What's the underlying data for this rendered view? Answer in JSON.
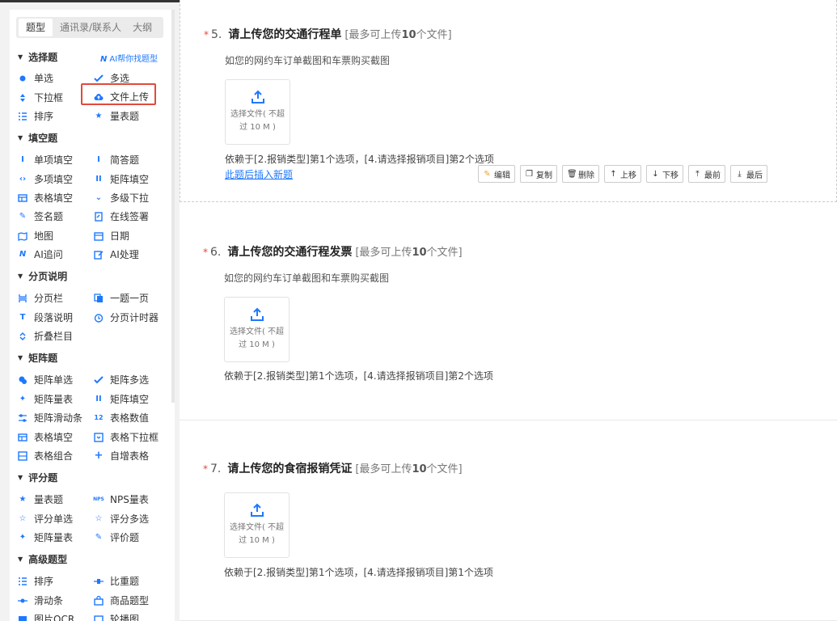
{
  "colors": {
    "accent": "#1e78ff",
    "required": "#e04a3b",
    "highlight": "#e04a3b"
  },
  "sidebar": {
    "tabs": [
      "题型",
      "通讯录/联系人",
      "大纲"
    ],
    "ai_find": "AI帮你找题型",
    "categories": {
      "choice": "选择题",
      "fill": "填空题",
      "paging": "分页说明",
      "matrix": "矩阵题",
      "rating": "评分题",
      "advanced": "高级题型"
    },
    "items": {
      "single": "单选",
      "multi": "多选",
      "dropdown": "下拉框",
      "file_upload": "文件上传",
      "sort": "排序",
      "scale": "量表题",
      "single_fill": "单项填空",
      "short_answer": "简答题",
      "multi_fill": "多项填空",
      "matrix_fill": "矩阵填空",
      "table_fill": "表格填空",
      "multi_dropdown": "多级下拉",
      "signature": "签名题",
      "online_sign": "在线签署",
      "map": "地图",
      "date": "日期",
      "ai_followup": "AI追问",
      "ai_process": "AI处理",
      "page_bar": "分页栏",
      "one_per_page": "一题一页",
      "paragraph": "段落说明",
      "page_timer": "分页计时器",
      "fold": "折叠栏目",
      "matrix_single": "矩阵单选",
      "matrix_multi": "矩阵多选",
      "matrix_scale": "矩阵量表",
      "matrix_fill2": "矩阵填空",
      "matrix_slider": "矩阵滑动条",
      "table_value": "表格数值",
      "table_fill2": "表格填空",
      "table_dropdown": "表格下拉框",
      "table_combo": "表格组合",
      "auto_table": "自增表格",
      "scale2": "量表题",
      "nps": "NPS量表",
      "rate_single": "评分单选",
      "rate_multi": "评分多选",
      "matrix_scale2": "矩阵量表",
      "evaluation": "评价题",
      "sort2": "排序",
      "weight": "比重题",
      "slider": "滑动条",
      "product": "商品题型",
      "ocr": "图片OCR",
      "carousel": "轮播图"
    }
  },
  "questions": [
    {
      "star": "*",
      "num": "5.",
      "title": "请上传您的交通行程单",
      "limit_prefix": "[最多可上传",
      "limit_count": "10",
      "limit_suffix": "个文件]",
      "desc": "如您的网约车订单截图和车票购买截图",
      "upload_line1": "选择文件( 不超",
      "upload_line2": "过 10 M )",
      "dep": "依赖于[2.报销类型]第1个选项，[4.请选择报销项目]第2个选项",
      "insert": "此题后插入新题"
    },
    {
      "star": "*",
      "num": "6.",
      "title": "请上传您的交通行程发票",
      "limit_prefix": "[最多可上传",
      "limit_count": "10",
      "limit_suffix": "个文件]",
      "desc": "如您的网约车订单截图和车票购买截图",
      "upload_line1": "选择文件( 不超",
      "upload_line2": "过 10 M )",
      "dep": "依赖于[2.报销类型]第1个选项，[4.请选择报销项目]第2个选项"
    },
    {
      "star": "*",
      "num": "7.",
      "title": "请上传您的食宿报销凭证",
      "limit_prefix": "[最多可上传",
      "limit_count": "10",
      "limit_suffix": "个文件]",
      "upload_line1": "选择文件( 不超",
      "upload_line2": "过 10 M )",
      "dep": "依赖于[2.报销类型]第1个选项，[4.请选择报销项目]第1个选项"
    }
  ],
  "toolbar": {
    "edit": "编辑",
    "copy": "复制",
    "delete": "删除",
    "up": "上移",
    "down": "下移",
    "first": "最前",
    "last": "最后"
  }
}
